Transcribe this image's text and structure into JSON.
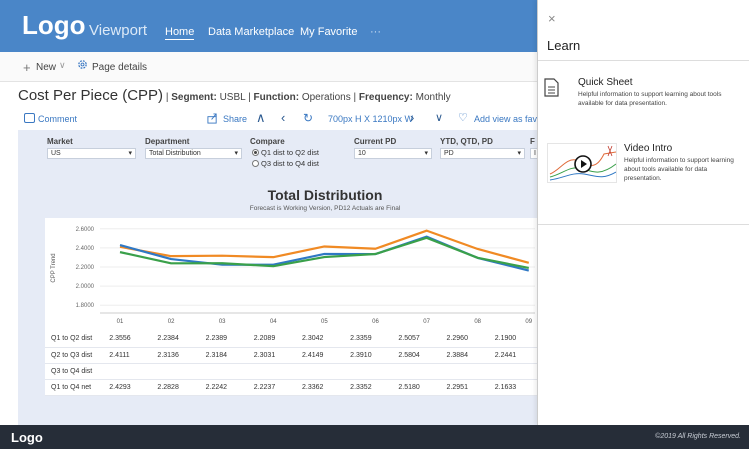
{
  "header": {
    "logo": "Logo",
    "app_name": "Viewport",
    "nav": [
      "Home",
      "Data Marketplace",
      "My Favorite",
      "···"
    ]
  },
  "toolbar": {
    "new_label": "New",
    "page_details_label": "Page details"
  },
  "page": {
    "title": "Cost Per Piece (CPP)",
    "segment_label": "Segment:",
    "segment_value": "USBL",
    "function_label": "Function:",
    "function_value": "Operations",
    "frequency_label": "Frequency:",
    "frequency_value": "Monthly"
  },
  "actions": {
    "comment": "Comment",
    "share": "Share",
    "size": "700px H X 1210px W",
    "add_favorite": "Add view as favorite"
  },
  "filters": {
    "market_label": "Market",
    "market_value": "US",
    "department_label": "Department",
    "department_value": "Total Distribution",
    "compare_label": "Compare",
    "compare_options": [
      "Q1 dist to Q2 dist",
      "Q3 dist to Q4 dist"
    ],
    "current_pd_label": "Current PD",
    "current_pd_value": "10",
    "ytd_label": "YTD, QTD, PD",
    "ytd_value": "PD",
    "extra_label": "F",
    "extra_value": "I"
  },
  "chart_data": {
    "type": "line",
    "title": "Total Distribution",
    "subtitle": "Forecast is Working Version, PD12 Actuals are Final",
    "ylabel": "CPP Trend",
    "xlabel": "",
    "categories": [
      "01",
      "02",
      "03",
      "04",
      "05",
      "06",
      "07",
      "08",
      "09"
    ],
    "yticks": [
      "2.6000",
      "2.4000",
      "2.2000",
      "2.0000",
      "1.8000"
    ],
    "ylim": [
      1.75,
      2.65
    ],
    "grid": true,
    "series": [
      {
        "values": [
          2.4111,
          2.3136,
          2.3184,
          2.3031,
          2.4149,
          2.391,
          2.5804,
          2.3884,
          2.2441
        ],
        "color": "#f08a24"
      },
      {
        "values": [
          2.4293,
          2.2828,
          2.2242,
          2.2237,
          2.3362,
          2.3352,
          2.518,
          2.2951,
          2.1633
        ],
        "color": "#2f78c4"
      },
      {
        "values": [
          2.3556,
          2.2384,
          2.2389,
          2.2089,
          2.3042,
          2.3359,
          2.5057,
          2.296,
          2.19
        ],
        "color": "#3aa04a"
      }
    ]
  },
  "table": {
    "rows": [
      {
        "label": "Q1 to Q2 dist",
        "values": [
          "2.3556",
          "2.2384",
          "2.2389",
          "2.2089",
          "2.3042",
          "2.3359",
          "2.5057",
          "2.2960",
          "2.1900"
        ]
      },
      {
        "label": "Q2 to Q3 dist",
        "values": [
          "2.4111",
          "2.3136",
          "2.3184",
          "2.3031",
          "2.4149",
          "2.3910",
          "2.5804",
          "2.3884",
          "2.2441"
        ]
      },
      {
        "label": "Q3 to Q4 dist",
        "values": [
          "",
          "",
          "",
          "",
          "",
          "",
          "",
          "",
          ""
        ]
      },
      {
        "label": "Q1 to Q4 net",
        "values": [
          "2.4293",
          "2.2828",
          "2.2242",
          "2.2237",
          "2.3362",
          "2.3352",
          "2.5180",
          "2.2951",
          "2.1633"
        ]
      }
    ]
  },
  "panel": {
    "close": "×",
    "title": "Learn",
    "quick_sheet_title": "Quick Sheet",
    "quick_sheet_desc": "Helpful information to support learning about tools available for data presentation.",
    "video_title": "Video Intro",
    "video_desc": "Helpful information to support learning about tools available for data presentation."
  },
  "footer": {
    "logo": "Logo",
    "copyright": "©2019 All Rights Reserved."
  }
}
